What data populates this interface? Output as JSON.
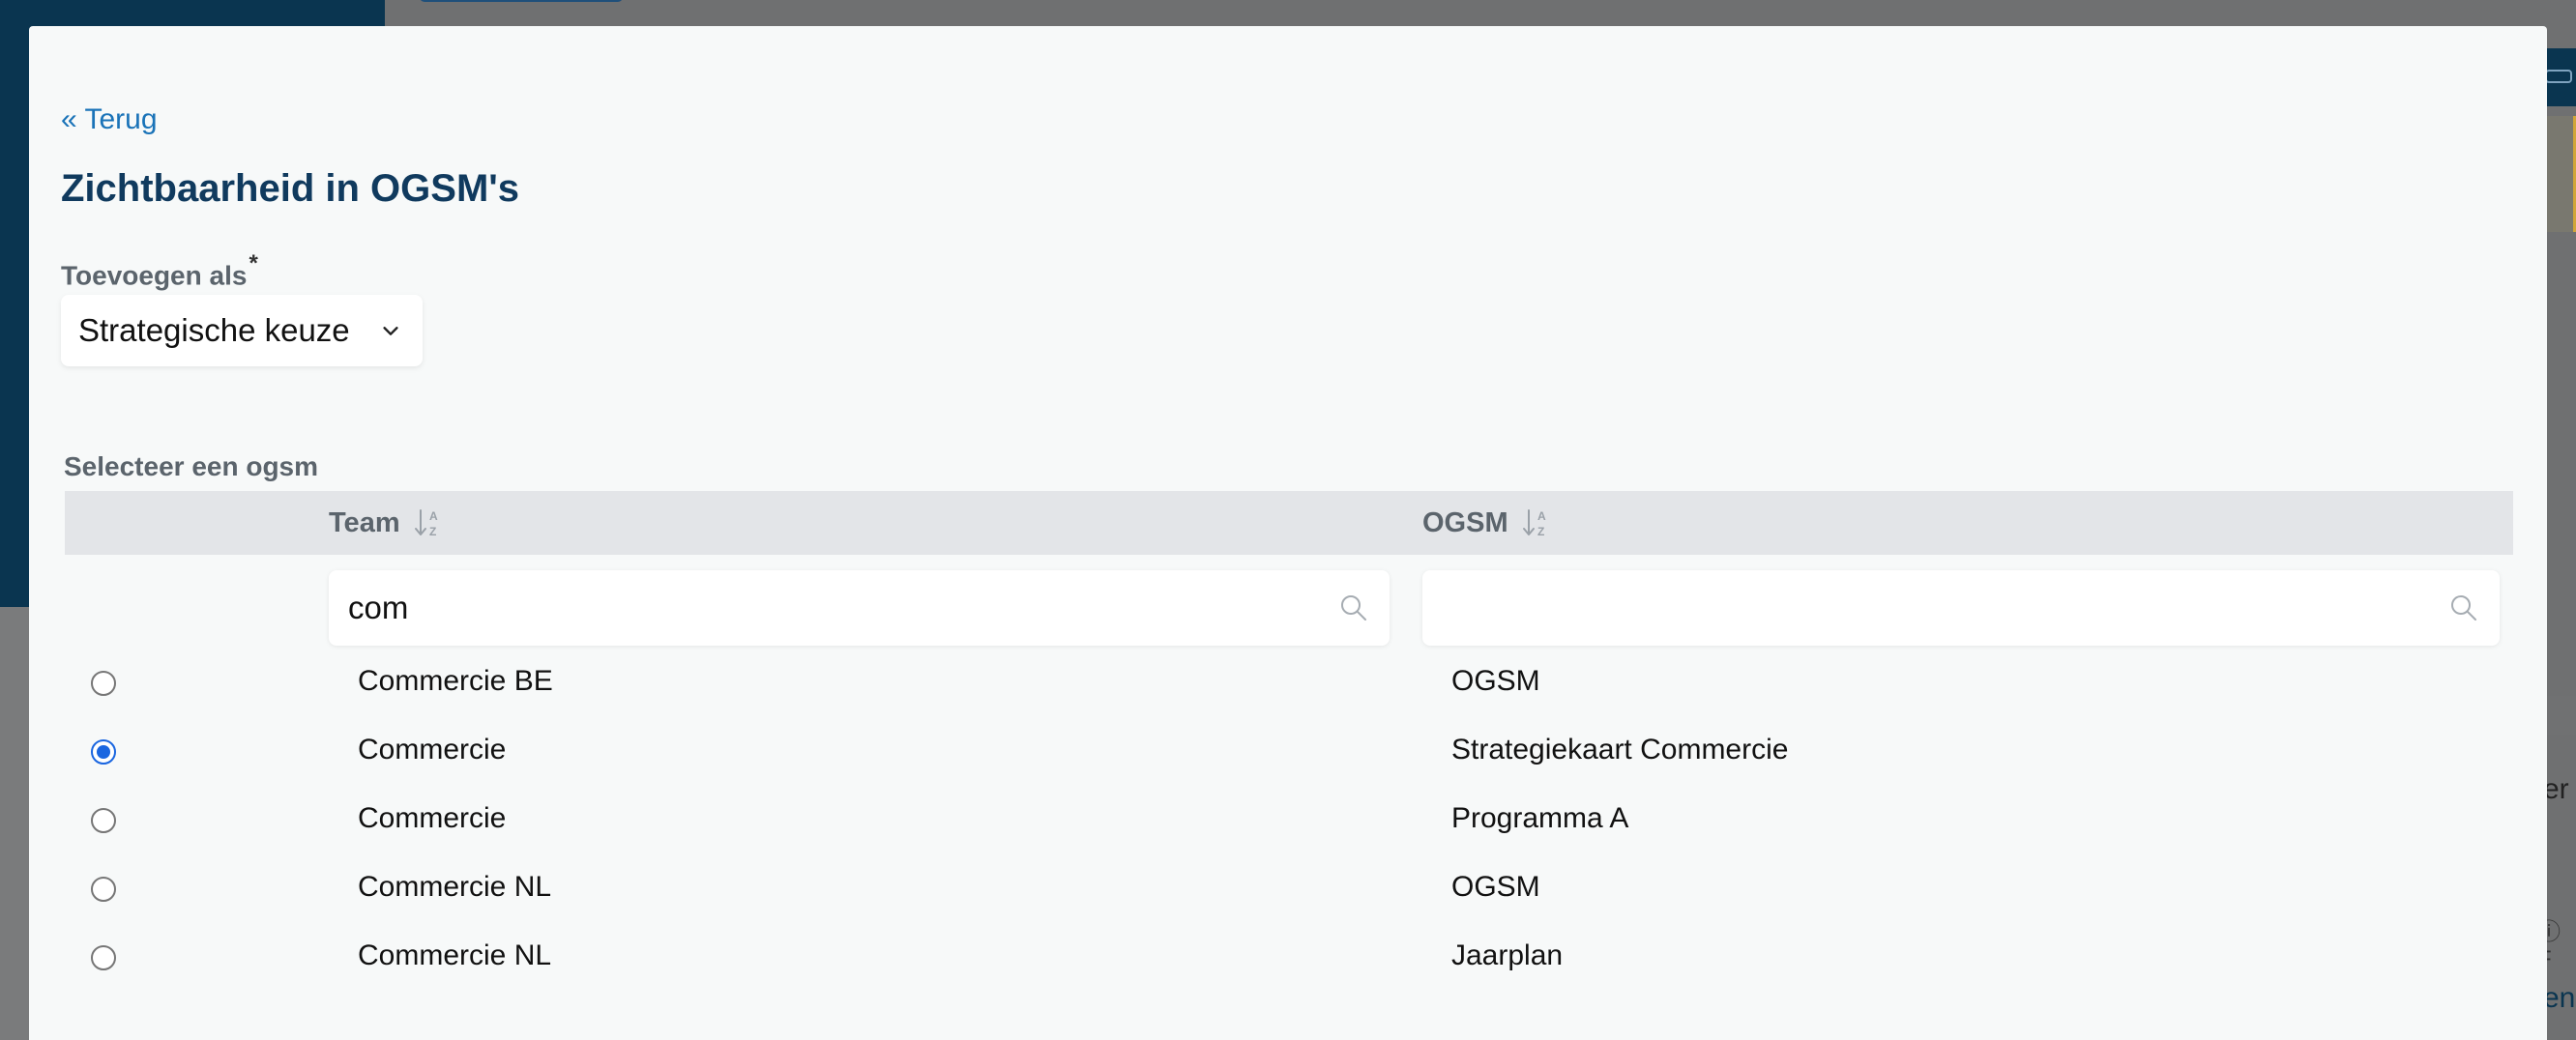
{
  "back_link": "« Terug",
  "title": "Zichtbaarheid in OGSM's",
  "add_as": {
    "label": "Toevoegen als",
    "required_mark": "*",
    "selected": "Strategische keuze"
  },
  "select_ogsm_label": "Selecteer een ogsm",
  "table": {
    "columns": [
      {
        "label": "Team"
      },
      {
        "label": "OGSM"
      }
    ],
    "filters": {
      "team": "com",
      "ogsm": ""
    },
    "rows": [
      {
        "team": "Commercie BE",
        "ogsm": "OGSM",
        "selected": false
      },
      {
        "team": "Commercie",
        "ogsm": "Strategiekaart Commercie",
        "selected": true
      },
      {
        "team": "Commercie",
        "ogsm": "Programma A",
        "selected": false
      },
      {
        "team": "Commercie NL",
        "ogsm": "OGSM",
        "selected": false
      },
      {
        "team": "Commercie NL",
        "ogsm": "Jaarplan",
        "selected": false
      }
    ]
  },
  "background": {
    "right_text_1": "er",
    "right_text_2": "ⓘ F",
    "right_text_3": "en"
  },
  "colors": {
    "title": "#103a5e",
    "link": "#1a73b8",
    "radio_checked": "#1a66e0",
    "header_bg": "#e3e5e8"
  }
}
